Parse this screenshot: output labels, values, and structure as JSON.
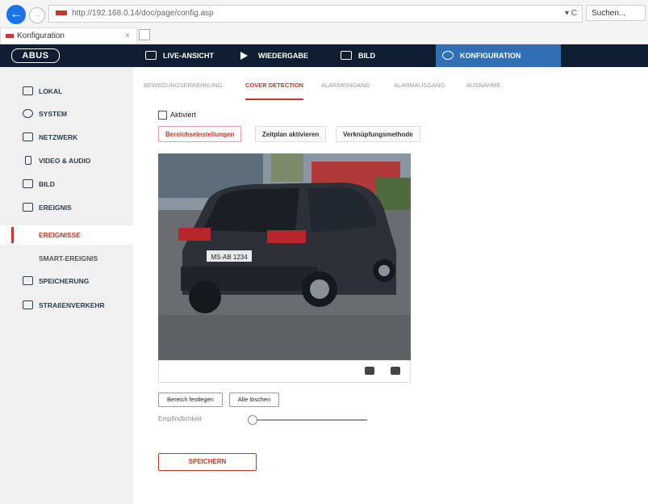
{
  "browser": {
    "url": "http://192.168.0.14/doc/page/config.asp",
    "search_placeholder": "Suchen...",
    "tab_title": "Konfiguration",
    "tab_close": "×"
  },
  "brand": {
    "logo": "ABUS"
  },
  "topnav": [
    {
      "label": "LIVE-ANSICHT",
      "icon": "camera-icon"
    },
    {
      "label": "WIEDERGABE",
      "icon": "play-icon"
    },
    {
      "label": "BILD",
      "icon": "image-icon"
    },
    {
      "label": "KONFIGURATION",
      "icon": "tools-icon",
      "active": true
    }
  ],
  "sidebar": {
    "items": [
      {
        "label": "LOKAL",
        "icon": "monitor-icon"
      },
      {
        "label": "SYSTEM",
        "icon": "gear-icon"
      },
      {
        "label": "NETZWERK",
        "icon": "network-icon"
      },
      {
        "label": "VIDEO & AUDIO",
        "icon": "mic-icon"
      },
      {
        "label": "BILD",
        "icon": "image-icon"
      },
      {
        "label": "EREIGNIS",
        "icon": "calendar-icon"
      },
      {
        "label": "EREIGNISSE",
        "active": true
      },
      {
        "label": "SMART-EREIGNIS"
      },
      {
        "label": "SPEICHERUNG",
        "icon": "storage-icon"
      },
      {
        "label": "STRAßENVERKEHR",
        "icon": "traffic-icon"
      }
    ]
  },
  "subtabs": [
    {
      "label": "BEWEGUNGSERKENNUNG"
    },
    {
      "label": "COVER DETECTION",
      "active": true
    },
    {
      "label": "ALARMEINGANG"
    },
    {
      "label": "ALARMAUSGANG"
    },
    {
      "label": "AUSNAHME"
    }
  ],
  "form": {
    "enabled_label": "Aktiviert",
    "enabled": false,
    "inner_tabs": [
      {
        "label": "Bereichseinstellungen",
        "active": true
      },
      {
        "label": "Zeitplan aktivieren"
      },
      {
        "label": "Verknüpfungsmethode"
      }
    ],
    "set_area_label": "Bereich festlegen",
    "clear_all_label": "Alle löschen",
    "sensitivity_label": "Empfindlichkeit",
    "sensitivity_value": 0,
    "save_label": "SPEICHERN"
  },
  "preview": {
    "plate_text": "MS-AB 1234",
    "toolbar_icons": [
      "record-icon",
      "snapshot-icon"
    ]
  },
  "colors": {
    "nav_bg": "#0f1e33",
    "nav_active": "#2f6fb3",
    "accent_red": "#c0392b",
    "sidebar_bg": "#f0f0f0"
  }
}
